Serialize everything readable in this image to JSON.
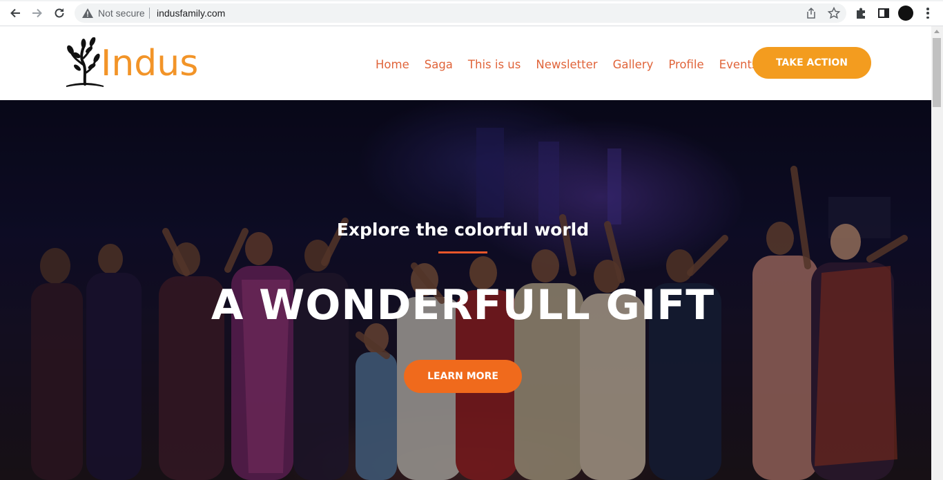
{
  "browser": {
    "security_label": "Not secure",
    "url": "indusfamily.com"
  },
  "site": {
    "logo_text": "Indus",
    "nav": [
      "Home",
      "Saga",
      "This is us",
      "Newsletter",
      "Gallery",
      "Profile",
      "Events"
    ],
    "cta_label": "TAKE ACTION"
  },
  "hero": {
    "kicker": "Explore the colorful world",
    "headline": "A WONDERFULL GIFT",
    "button_label": "LEARN MORE"
  },
  "colors": {
    "brand_orange": "#f29428",
    "nav_link": "#e0643a",
    "cta_bg": "#f39c1f",
    "learn_bg": "#f06a1c",
    "accent_line": "#e8562a"
  }
}
